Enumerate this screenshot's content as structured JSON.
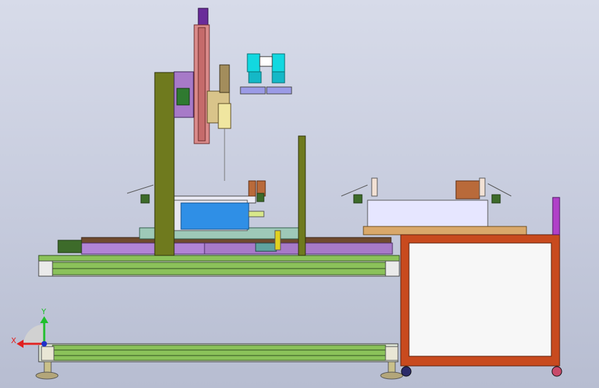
{
  "triad": {
    "x_label": "X",
    "y_label": "Y"
  },
  "colors": {
    "background_top": "#d7dbe9",
    "background_bottom": "#b7bdd1",
    "frame_green": "#8bc25a",
    "upright_olive": "#6f7a1e",
    "slide_purple": "#a77ac8",
    "cart_orange": "#c84a1e",
    "cart_fill": "#f7f7f7",
    "tray_blue": "#2f8fe6",
    "sensor_cyan": "#12d8e0",
    "gauge_purple": "#b040c8"
  }
}
